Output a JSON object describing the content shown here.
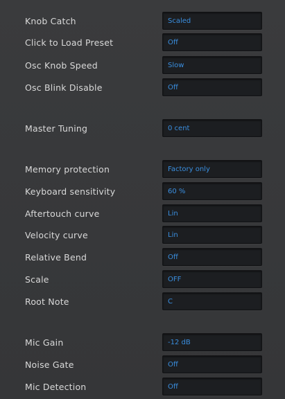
{
  "settings": [
    {
      "label": "Knob Catch",
      "value": "Scaled"
    },
    {
      "label": "Click to Load Preset",
      "value": "Off"
    },
    {
      "label": "Osc Knob Speed",
      "value": "Slow"
    },
    {
      "label": "Osc Blink Disable",
      "value": "Off"
    },
    {
      "label": "Master Tuning",
      "value": "0 cent"
    },
    {
      "label": "Memory protection",
      "value": "Factory only"
    },
    {
      "label": "Keyboard sensitivity",
      "value": "60 %"
    },
    {
      "label": "Aftertouch curve",
      "value": "Lin"
    },
    {
      "label": "Velocity curve",
      "value": "Lin"
    },
    {
      "label": "Relative Bend",
      "value": "Off"
    },
    {
      "label": "Scale",
      "value": "OFF"
    },
    {
      "label": "Root Note",
      "value": "C"
    },
    {
      "label": "Mic Gain",
      "value": "-12 dB"
    },
    {
      "label": "Noise Gate",
      "value": "Off"
    },
    {
      "label": "Mic Detection",
      "value": "Off"
    }
  ],
  "colors": {
    "background": "#37383a",
    "label_text": "#d9d9d9",
    "field_background": "#1c1e21",
    "value_text": "#3a8fe0"
  }
}
